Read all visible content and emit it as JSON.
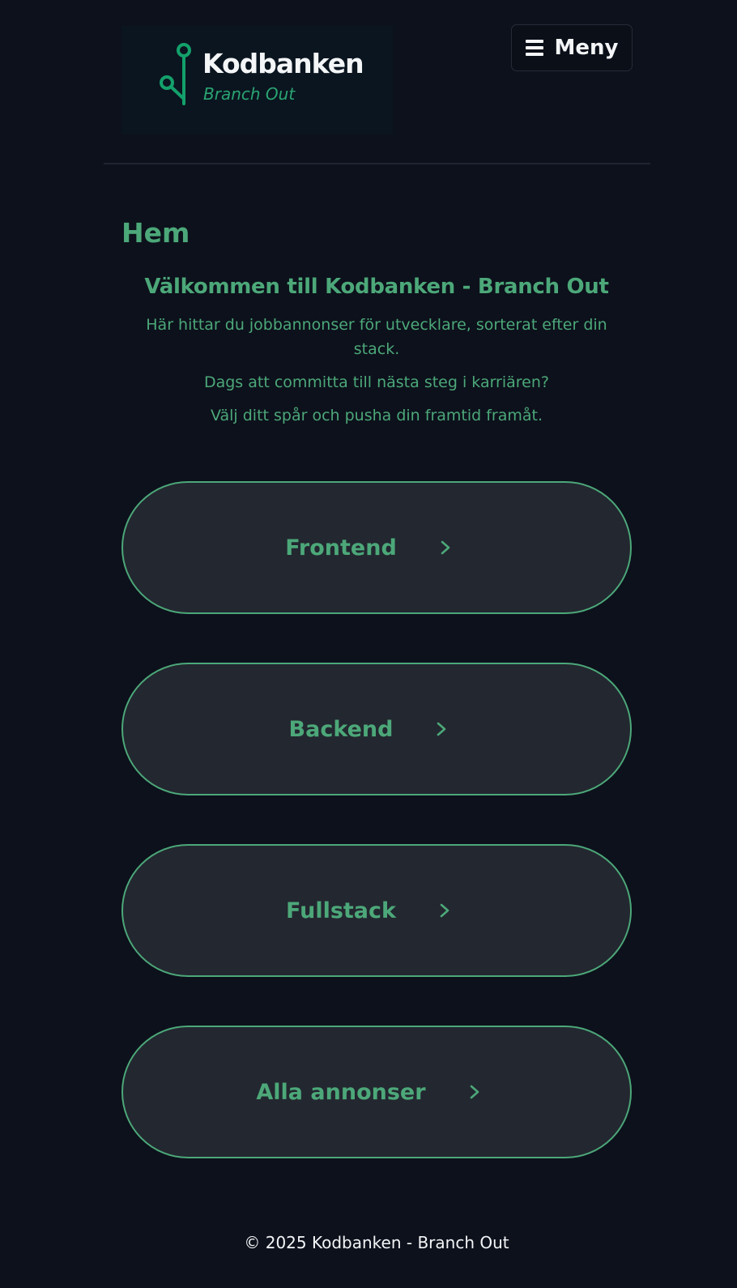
{
  "header": {
    "logo_title": "Kodbanken",
    "logo_subtitle": "Branch Out",
    "logo_icon": "branch-icon",
    "menu_label": "Meny",
    "menu_icon": "hamburger-icon"
  },
  "main": {
    "page_title": "Hem",
    "welcome_heading": "Välkommen till Kodbanken - Branch Out",
    "paragraphs": [
      "Här hittar du jobbannonser för utvecklare, sorterat efter din stack.",
      "Dags att committa till nästa steg i karriären?",
      "Välj ditt spår och pusha din framtid framåt."
    ],
    "categories": [
      {
        "label": "Frontend",
        "icon": "chevron-right-icon"
      },
      {
        "label": "Backend",
        "icon": "chevron-right-icon"
      },
      {
        "label": "Fullstack",
        "icon": "chevron-right-icon"
      },
      {
        "label": "Alla annonser",
        "icon": "chevron-right-icon"
      }
    ]
  },
  "footer": {
    "copyright": "© 2025 Kodbanken - Branch Out"
  },
  "colors": {
    "background": "#0c111b",
    "accent": "#4ca779",
    "logo_accent": "#2aa472",
    "button_fill": "#23272f",
    "text_light": "#f3f5f7"
  }
}
